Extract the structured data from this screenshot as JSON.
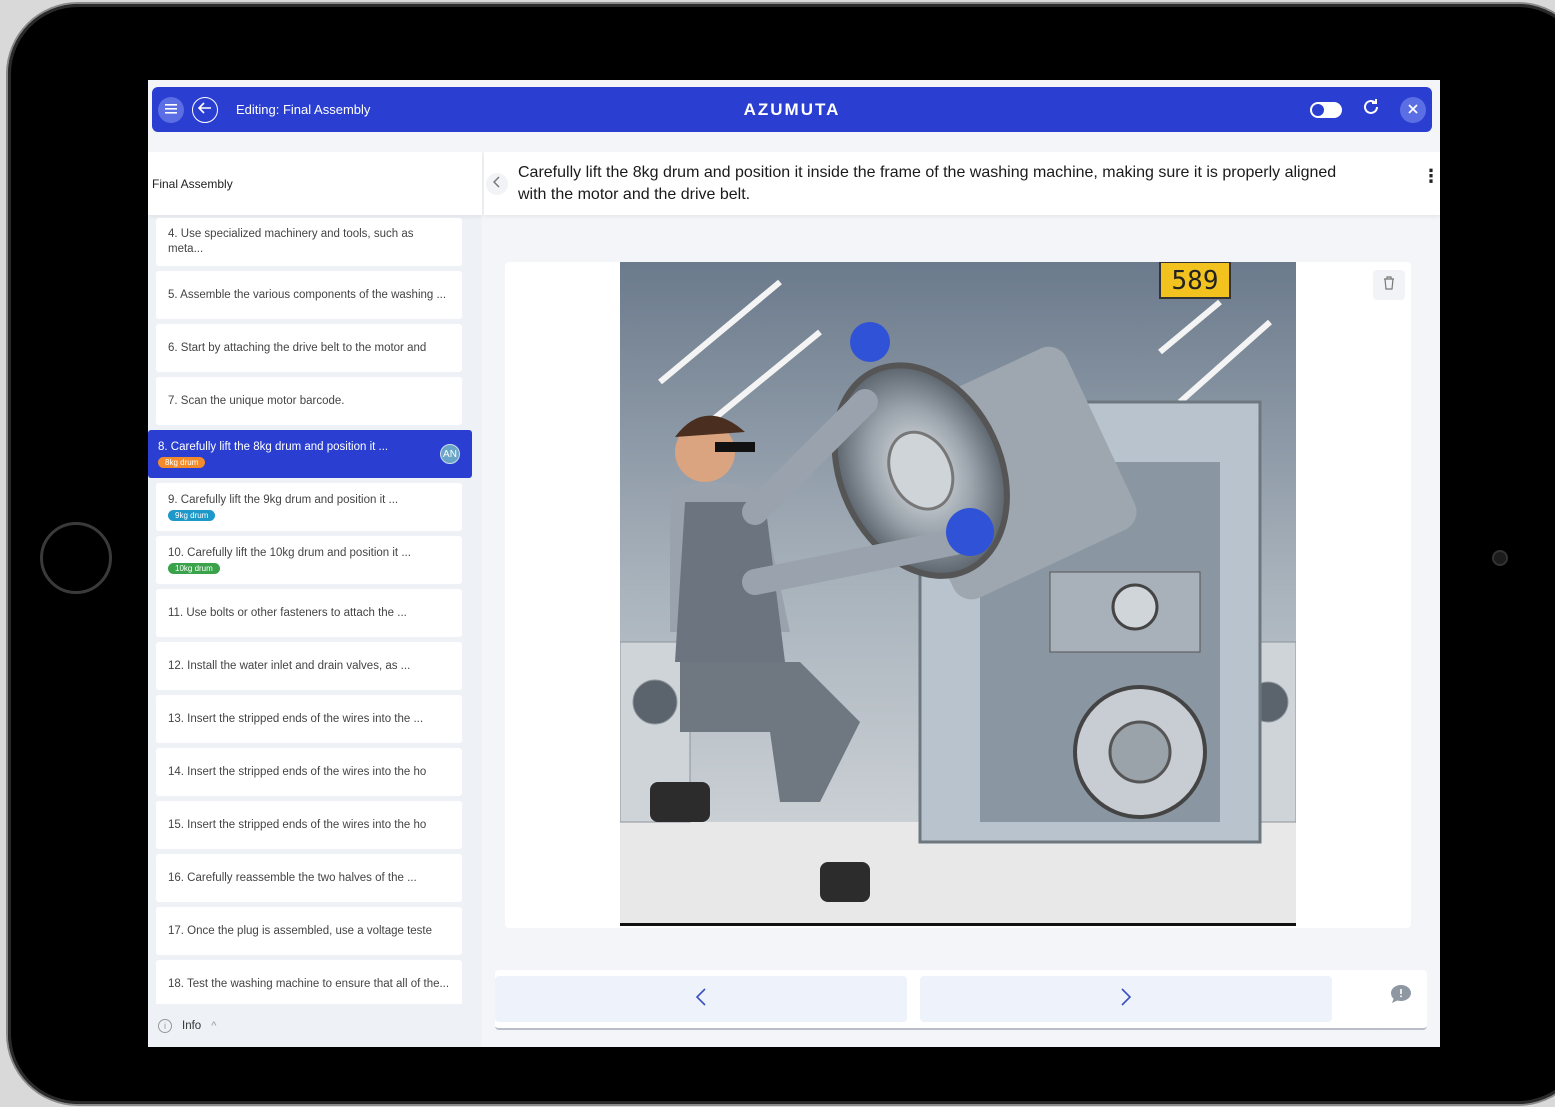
{
  "topbar": {
    "title": "Editing: Final Assembly",
    "brand": "AZUMUTA"
  },
  "sidebar": {
    "header": "Final Assembly",
    "steps": [
      {
        "label": "4. Use specialized machinery and tools, such as meta...",
        "active": false
      },
      {
        "label": "5. Assemble the various components of the washing ...",
        "active": false
      },
      {
        "label": "6. Start by attaching the drive belt to the motor and",
        "active": false
      },
      {
        "label": "7. Scan the unique motor barcode.",
        "active": false
      },
      {
        "label": "8. Carefully lift the 8kg drum and position it ...",
        "active": true,
        "tag": "8kg drum",
        "tag_color": "#f28b2c",
        "avatar": "AN"
      },
      {
        "label": "9. Carefully lift the 9kg drum and position it ...",
        "active": false,
        "tag": "9kg drum",
        "tag_color": "#1e98c9"
      },
      {
        "label": "10. Carefully lift the 10kg drum and position it ...",
        "active": false,
        "tag": "10kg drum",
        "tag_color": "#3aa24a"
      },
      {
        "label": "11. Use bolts or other fasteners to attach the ...",
        "active": false
      },
      {
        "label": "12. Install the water inlet and drain valves, as ...",
        "active": false
      },
      {
        "label": "13. Insert the stripped ends of the wires into the ...",
        "active": false
      },
      {
        "label": "14. Insert the stripped ends of the wires into the ho",
        "active": false
      },
      {
        "label": "15. Insert the stripped ends of the wires into the ho",
        "active": false
      },
      {
        "label": "16. Carefully reassemble the two halves of the ...",
        "active": false
      },
      {
        "label": "17. Once the plug is assembled, use a voltage teste",
        "active": false
      },
      {
        "label": "18. Test the washing machine to ensure that all of the...",
        "active": false
      }
    ],
    "footer_label": "Info"
  },
  "main": {
    "instruction": "Carefully lift the 8kg drum and position it inside the frame of the washing machine, making sure it is properly aligned with the motor and the drive belt.",
    "photo_badge": "589",
    "fab_label": "+"
  },
  "colors": {
    "accent": "#2a3fd1",
    "fab": "#f7c81b"
  }
}
